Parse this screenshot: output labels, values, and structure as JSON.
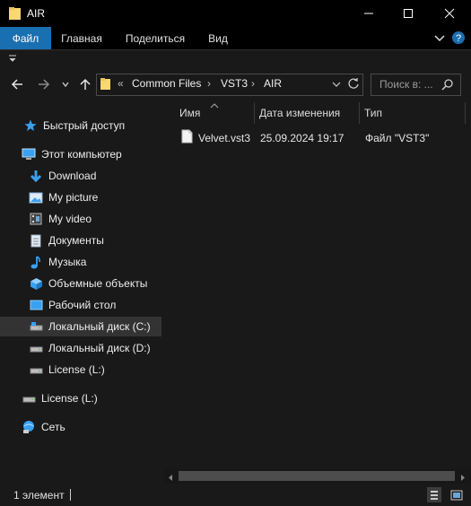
{
  "window": {
    "title": "AIR"
  },
  "ribbon": {
    "tabs": [
      {
        "label": "Файл"
      },
      {
        "label": "Главная"
      },
      {
        "label": "Поделиться"
      },
      {
        "label": "Вид"
      }
    ]
  },
  "address": {
    "overflow": "«",
    "crumbs": [
      "Common Files",
      "VST3",
      "AIR"
    ]
  },
  "search": {
    "placeholder": "Поиск в: ..."
  },
  "sidebar": {
    "quick_access": "Быстрый доступ",
    "this_pc": "Этот компьютер",
    "items": [
      {
        "label": "Download",
        "icon": "download-icon"
      },
      {
        "label": "My picture",
        "icon": "pictures-icon"
      },
      {
        "label": "My video",
        "icon": "video-icon"
      },
      {
        "label": "Документы",
        "icon": "documents-icon"
      },
      {
        "label": "Музыка",
        "icon": "music-icon"
      },
      {
        "label": "Объемные объекты",
        "icon": "3d-objects-icon"
      },
      {
        "label": "Рабочий стол",
        "icon": "desktop-icon"
      },
      {
        "label": "Локальный диск (C:)",
        "icon": "drive-icon"
      },
      {
        "label": "Локальный диск (D:)",
        "icon": "drive-icon"
      },
      {
        "label": "License (L:)",
        "icon": "drive-icon"
      }
    ],
    "license_root": "License (L:)",
    "network": "Сеть"
  },
  "columns": {
    "name": "Имя",
    "date": "Дата изменения",
    "type": "Тип"
  },
  "files": [
    {
      "name": "Velvet.vst3",
      "date": "25.09.2024 19:17",
      "type": "Файл \"VST3\""
    }
  ],
  "status": {
    "count": "1 элемент"
  },
  "colors": {
    "accent": "#1a6fb0",
    "background": "#191919",
    "folder": "#f8d775"
  }
}
